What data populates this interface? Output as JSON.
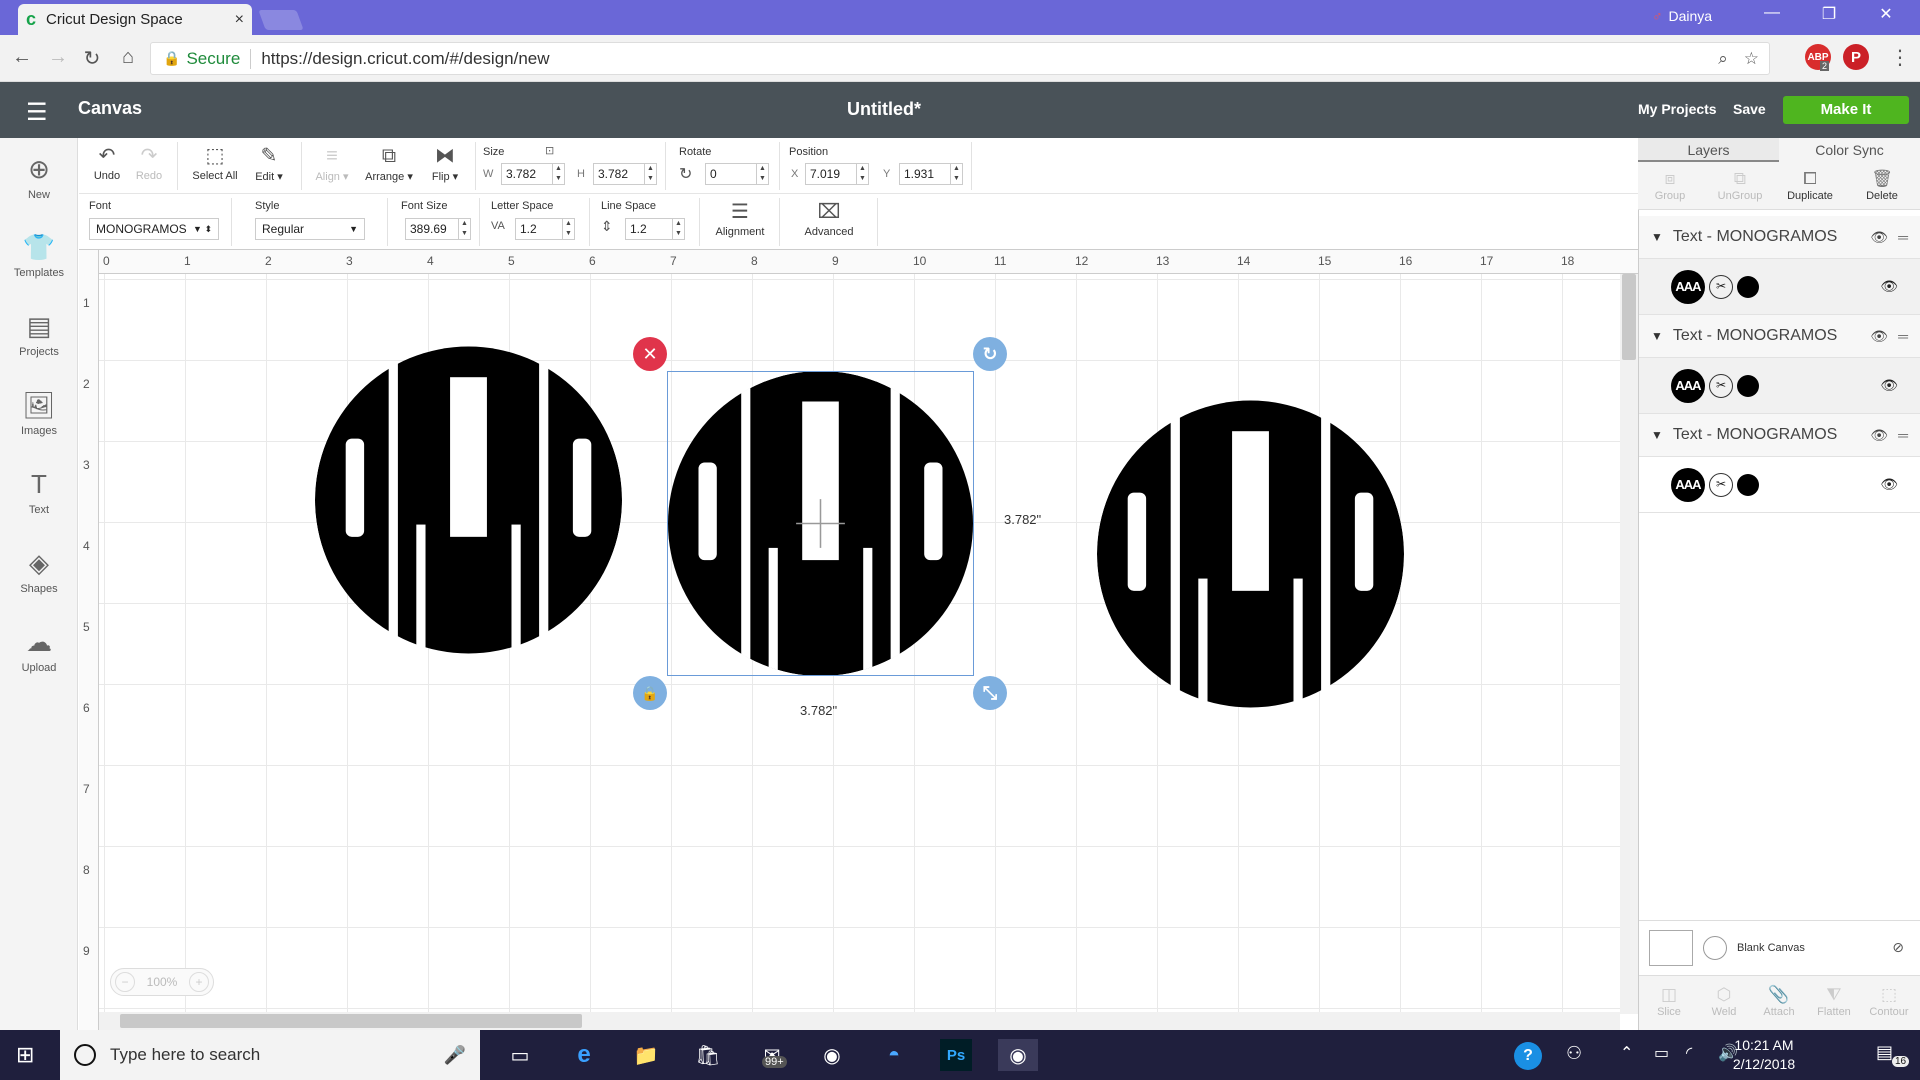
{
  "browser": {
    "tab_title": "Cricut Design Space",
    "tab_close": "×",
    "user": "Dainya",
    "secure_label": "Secure",
    "url": "https://design.cricut.com/#/design/new",
    "ext_abp": "ABP",
    "ext_abp_badge": "2"
  },
  "header": {
    "section": "Canvas",
    "doc_title": "Untitled*",
    "my_projects": "My Projects",
    "save": "Save",
    "make_it": "Make It"
  },
  "sidebar": {
    "items": [
      {
        "label": "New"
      },
      {
        "label": "Templates"
      },
      {
        "label": "Projects"
      },
      {
        "label": "Images"
      },
      {
        "label": "Text"
      },
      {
        "label": "Shapes"
      },
      {
        "label": "Upload"
      }
    ]
  },
  "toolbar": {
    "undo": "Undo",
    "redo": "Redo",
    "select_all": "Select All",
    "edit": "Edit",
    "align": "Align",
    "arrange": "Arrange",
    "flip": "Flip",
    "size_label": "Size",
    "w_label": "W",
    "w_value": "3.782",
    "h_label": "H",
    "h_value": "3.782",
    "rotate_label": "Rotate",
    "rotate_value": "0",
    "position_label": "Position",
    "x_label": "X",
    "x_value": "7.019",
    "y_label": "Y",
    "y_value": "1.931"
  },
  "text_toolbar": {
    "font_label": "Font",
    "font_value": "MONOGRAMOS",
    "style_label": "Style",
    "style_value": "Regular",
    "font_size_label": "Font Size",
    "font_size_value": "389.69",
    "letter_space_label": "Letter Space",
    "letter_space_value": "1.2",
    "line_space_label": "Line Space",
    "line_space_value": "1.2",
    "alignment": "Alignment",
    "advanced": "Advanced"
  },
  "ruler": {
    "h": [
      "0",
      "1",
      "2",
      "3",
      "4",
      "5",
      "6",
      "7",
      "8",
      "9",
      "10",
      "11",
      "12",
      "13",
      "14",
      "15",
      "16",
      "17",
      "18"
    ],
    "v": [
      "1",
      "2",
      "3",
      "4",
      "5",
      "6",
      "7",
      "8",
      "9"
    ]
  },
  "canvas": {
    "width_dim": "3.782\"",
    "height_dim": "3.782\"",
    "zoom": "100%"
  },
  "right_panel": {
    "tab_layers": "Layers",
    "tab_color_sync": "Color Sync",
    "tools": [
      {
        "label": "Group"
      },
      {
        "label": "UnGroup"
      },
      {
        "label": "Duplicate"
      },
      {
        "label": "Delete"
      }
    ],
    "layers": [
      {
        "name": "Text - MONOGRAMOS"
      },
      {
        "name": "Text - MONOGRAMOS"
      },
      {
        "name": "Text - MONOGRAMOS"
      }
    ],
    "blank_canvas": "Blank Canvas",
    "bottom_tools": [
      {
        "label": "Slice"
      },
      {
        "label": "Weld"
      },
      {
        "label": "Attach"
      },
      {
        "label": "Flatten"
      },
      {
        "label": "Contour"
      }
    ]
  },
  "taskbar": {
    "search_placeholder": "Type here to search",
    "mail_badge": "99+",
    "ps_label": "Ps",
    "time": "10:21 AM",
    "date": "2/12/2018",
    "notif_count": "16"
  }
}
